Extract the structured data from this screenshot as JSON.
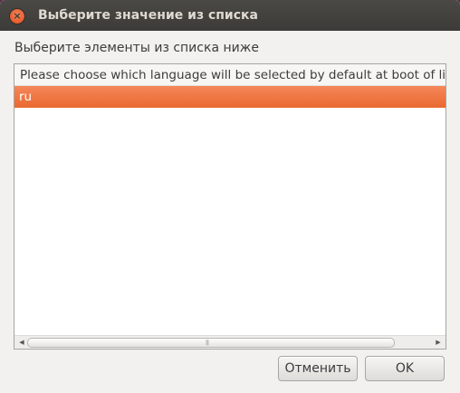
{
  "window": {
    "title": "Выберите значение из списка",
    "close_glyph": "×",
    "close_icon": "close-icon"
  },
  "dialog": {
    "prompt": "Выберите элементы из списка ниже"
  },
  "list": {
    "header": "Please choose which language will be selected by default at boot of live",
    "items": [
      {
        "label": "ru",
        "selected": true
      }
    ]
  },
  "scrollbar": {
    "left_arrow": "◀",
    "right_arrow": "▶",
    "grip": "|||"
  },
  "buttons": {
    "cancel_label": "Отменить",
    "ok_label": "OK"
  },
  "colors": {
    "selection": "#e9692f",
    "titlebar": "#3c3b37",
    "close_button": "#de4a17"
  }
}
